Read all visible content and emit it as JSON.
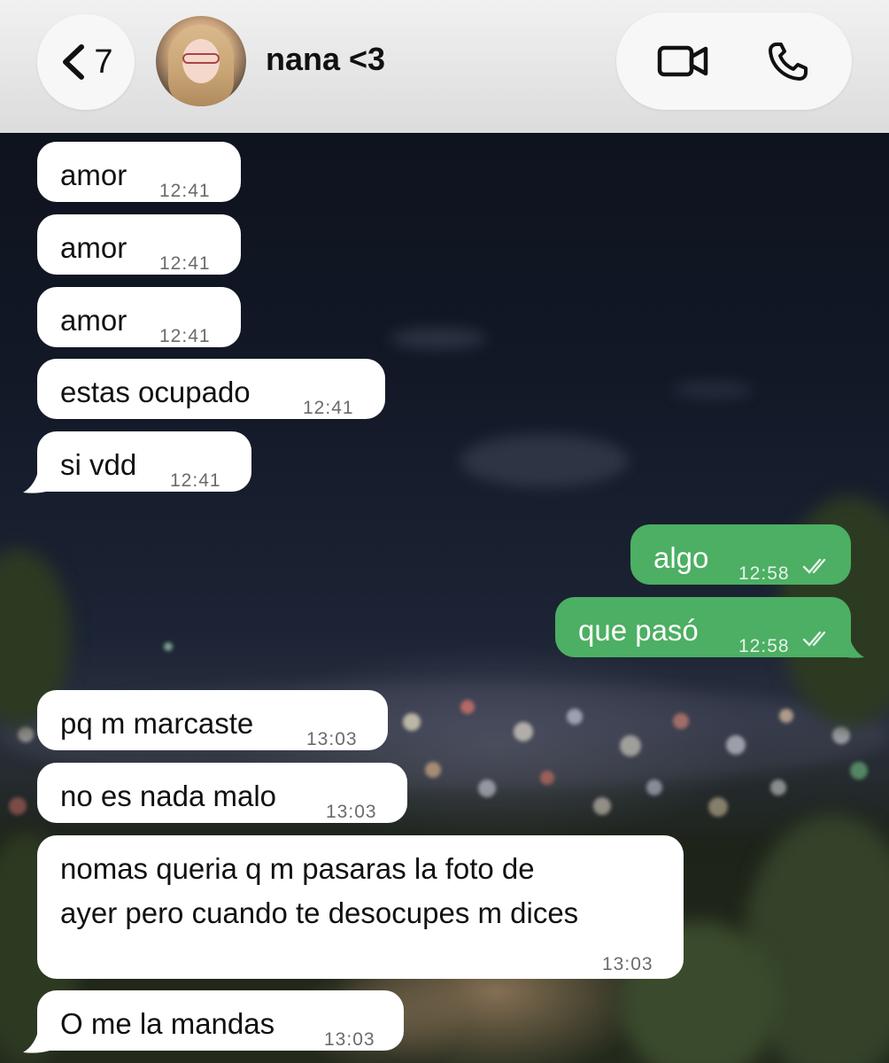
{
  "header": {
    "back_count": "7",
    "contact_name": "nana <3"
  },
  "messages": [
    {
      "dir": "in",
      "text": "amor",
      "time": "12:41"
    },
    {
      "dir": "in",
      "text": "amor",
      "time": "12:41"
    },
    {
      "dir": "in",
      "text": "amor",
      "time": "12:41"
    },
    {
      "dir": "in",
      "text": "estas ocupado",
      "time": "12:41"
    },
    {
      "dir": "in",
      "text": "si vdd",
      "time": "12:41"
    },
    {
      "dir": "out",
      "text": "algo",
      "time": "12:58",
      "status": "read"
    },
    {
      "dir": "out",
      "text": "que pasó",
      "time": "12:58",
      "status": "read"
    },
    {
      "dir": "in",
      "text": "pq m marcaste",
      "time": "13:03"
    },
    {
      "dir": "in",
      "text": "no es nada malo",
      "time": "13:03"
    },
    {
      "dir": "in",
      "text_line1": "nomas queria q m pasaras la foto de",
      "text_line2": "ayer pero cuando te desocupes m dices",
      "time": "13:03"
    },
    {
      "dir": "in",
      "text": "O me la mandas",
      "time": "13:03"
    }
  ],
  "colors": {
    "outgoing_bubble": "#4caf63",
    "incoming_bubble": "#ffffff",
    "header_bg": "#e6e6e6"
  },
  "icons": {
    "back": "chevron-left-icon",
    "video": "video-camera-icon",
    "phone": "phone-icon",
    "read_status": "double-check-icon"
  }
}
